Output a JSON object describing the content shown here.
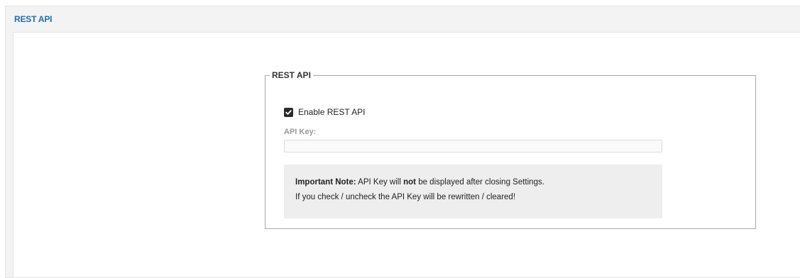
{
  "panel": {
    "title": "REST API"
  },
  "group": {
    "legend": "REST API",
    "enable_checkbox": {
      "label": "Enable REST API",
      "checked": true
    },
    "api_key": {
      "label": "API Key:",
      "value": "",
      "placeholder": ""
    },
    "note": {
      "title": "Important Note:",
      "line1_part1": "API Key will",
      "line1_emphasis": "not",
      "line1_part2": "be displayed after closing Settings.",
      "line2": "If you check / uncheck the API Key will be rewritten / cleared!"
    }
  },
  "colors": {
    "header_text": "#1f6fb2",
    "panel_bg": "#f3f3f3",
    "note_bg": "#eeeeee",
    "checkbox_fill": "#2a2a2a"
  }
}
